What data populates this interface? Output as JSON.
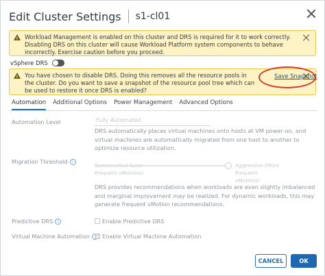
{
  "dialog": {
    "title": "Edit Cluster Settings",
    "subtitle": "s1-cl01"
  },
  "alerts": [
    {
      "text": "Workload Management is enabled on this cluster and DRS is required for it to work correctly. Disabling DRS on this cluster will cause Workload Platform system components to behave incorrectly. Exercise caution before you proceed."
    },
    {
      "text": "You have chosen to disable DRS. Doing this removes all the resource pools in the cluster. Do you want to save a snapshot of the resource pool tree which can be used to restore it once DRS is enabled?",
      "action_label": "Save Snapshot"
    }
  ],
  "drs_toggle": {
    "label": "vSphere DRS",
    "enabled": false
  },
  "tabs": [
    {
      "label": "Automation",
      "active": true
    },
    {
      "label": "Additional Options",
      "active": false
    },
    {
      "label": "Power Management",
      "active": false
    },
    {
      "label": "Advanced Options",
      "active": false
    }
  ],
  "automation": {
    "automation_level_label": "Automation Level",
    "automation_level_value": "Fully Automated",
    "automation_level_desc": "DRS automatically places virtual machines onto hosts at VM power-on, and virtual machines are automatically migrated from one host to another to optimize resource utilization.",
    "migration_threshold_label": "Migration Threshold",
    "slider_left_label": "Conservative (Less Frequent vMotions)",
    "slider_right_label": "Aggressive (More Frequent vMotions)",
    "slider_level": 1.0,
    "migration_desc": "DRS provides recommendations when workloads are even slightly imbalanced and marginal improvement may be realized. For dynamic workloads, this may generate frequent vMotion recommendations.",
    "predictive_drs_label": "Predictive DRS",
    "predictive_drs_checkbox": "Enable Predictive DRS",
    "predictive_drs_checked": false,
    "vm_automation_label": "Virtual Machine Automation",
    "vm_automation_checkbox": "Enable Virtual Machine Automation",
    "vm_automation_checked": true
  },
  "footer": {
    "cancel_label": "CANCEL",
    "ok_label": "OK"
  },
  "colors": {
    "accent": "#1d68b1",
    "warning_bg": "#fdf3c4",
    "highlight": "#d23a2a"
  }
}
